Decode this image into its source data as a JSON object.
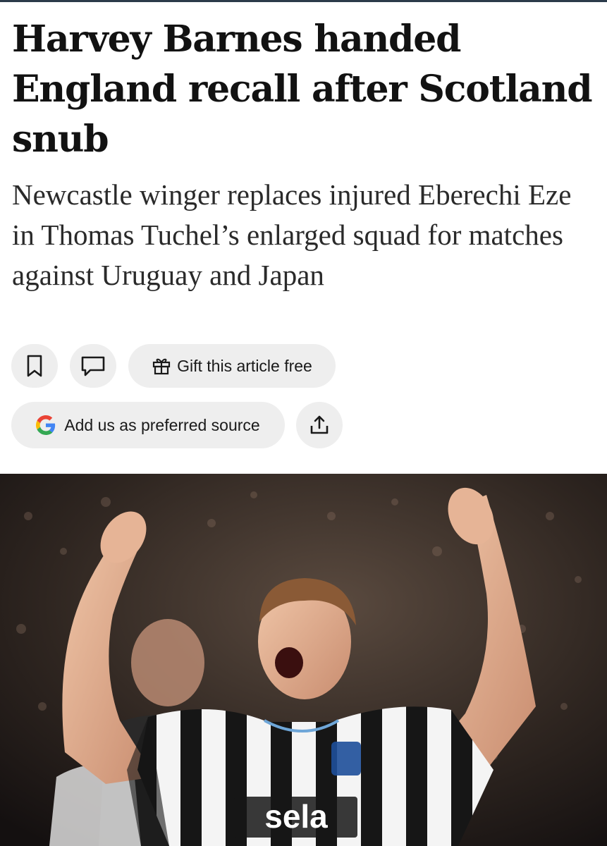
{
  "article": {
    "headline": "Harvey Barnes handed England recall after Scotland snub",
    "standfirst": "Newcastle winger replaces injured Eberechi Eze in Thomas Tuchel’s enlarged squad for matches against Uruguay and Japan"
  },
  "actions": {
    "save_icon": "bookmark-icon",
    "comment_icon": "comment-icon",
    "gift_label": "Gift this article free",
    "gift_icon": "gift-icon",
    "source_label": "Add us as preferred source",
    "source_icon": "google-g-icon",
    "share_icon": "share-icon"
  },
  "hero_image": {
    "shirt_sponsor": "sela"
  }
}
